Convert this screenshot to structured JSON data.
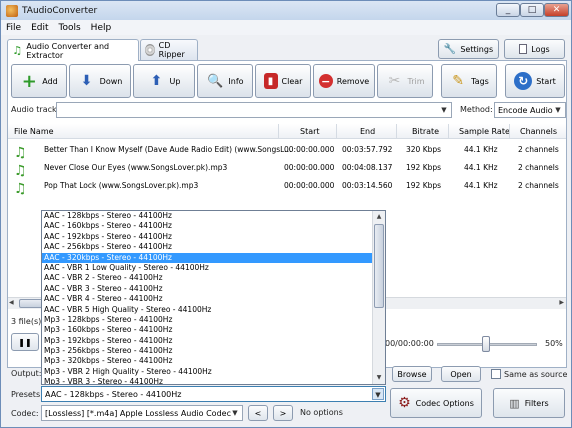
{
  "window": {
    "title": "TAudioConverter"
  },
  "menu": [
    "File",
    "Edit",
    "Tools",
    "Help"
  ],
  "tabs": [
    {
      "label": "Audio Converter and Extractor"
    },
    {
      "label": "CD Ripper"
    }
  ],
  "top_buttons": {
    "settings": "Settings",
    "logs": "Logs"
  },
  "toolbar": {
    "add": "Add",
    "down": "Down",
    "up": "Up",
    "info": "Info",
    "clear": "Clear",
    "remove": "Remove",
    "trim": "Trim",
    "tags": "Tags",
    "start": "Start"
  },
  "audio_track": {
    "label": "Audio track:",
    "value": ""
  },
  "method": {
    "label": "Method:",
    "value": "Encode Audio"
  },
  "table": {
    "columns": [
      "File Name",
      "Start",
      "End",
      "Bitrate",
      "Sample Rate",
      "Channels"
    ],
    "rows": [
      {
        "name": "Better Than I Know Myself (Dave Aude Radio Edit) (www.SongsL...",
        "start": "00:00:00.000",
        "end": "00:03:57.792",
        "bitrate": "320 Kbps",
        "rate": "44.1 KHz",
        "channels": "2 channels"
      },
      {
        "name": "Never Close Our Eyes (www.SongsLover.pk).mp3",
        "start": "00:00:00.000",
        "end": "00:04:08.137",
        "bitrate": "192 Kbps",
        "rate": "44.1 KHz",
        "channels": "2 channels"
      },
      {
        "name": "Pop That Lock (www.SongsLover.pk).mp3",
        "start": "00:00:00.000",
        "end": "00:03:14.560",
        "bitrate": "192 Kbps",
        "rate": "44.1 KHz",
        "channels": "2 channels"
      }
    ]
  },
  "status": {
    "file_count": "3 file(s)",
    "time": "00/00:00:00",
    "volume": "50%"
  },
  "volume_level": 0.5,
  "output": {
    "label": "Output:",
    "browse": "Browse",
    "open": "Open",
    "same_as_source": "Same as source"
  },
  "presets": {
    "label": "Presets:",
    "value": "AAC - 128kbps - Stereo - 44100Hz",
    "options": [
      "AAC - 128kbps - Stereo - 44100Hz",
      "AAC - 160kbps - Stereo - 44100Hz",
      "AAC - 192kbps - Stereo - 44100Hz",
      "AAC - 256kbps - Stereo - 44100Hz",
      "AAC - 320kbps - Stereo - 44100Hz",
      "AAC - VBR 1 Low Quality - Stereo - 44100Hz",
      "AAC - VBR 2 - Stereo - 44100Hz",
      "AAC - VBR 3 - Stereo - 44100Hz",
      "AAC - VBR 4 - Stereo - 44100Hz",
      "AAC - VBR 5 High Quality - Stereo - 44100Hz",
      "Mp3 - 128kbps - Stereo - 44100Hz",
      "Mp3 - 160kbps - Stereo - 44100Hz",
      "Mp3 - 192kbps - Stereo - 44100Hz",
      "Mp3 - 256kbps - Stereo - 44100Hz",
      "Mp3 - 320kbps - Stereo - 44100Hz",
      "Mp3 - VBR 2 High Quality - Stereo - 44100Hz",
      "Mp3 - VBR 3 - Stereo - 44100Hz"
    ],
    "selected_index": 4
  },
  "codec": {
    "label": "Codec:",
    "value": "[Lossless] [*.m4a] Apple Lossless Audio Codec",
    "prev": "<",
    "next": ">",
    "options_text": "No options"
  },
  "big_buttons": {
    "codec_options": "Codec Options",
    "filters": "Filters"
  },
  "colors": {
    "accent": "#3399ff",
    "green_icon": "#3a9a2a"
  }
}
